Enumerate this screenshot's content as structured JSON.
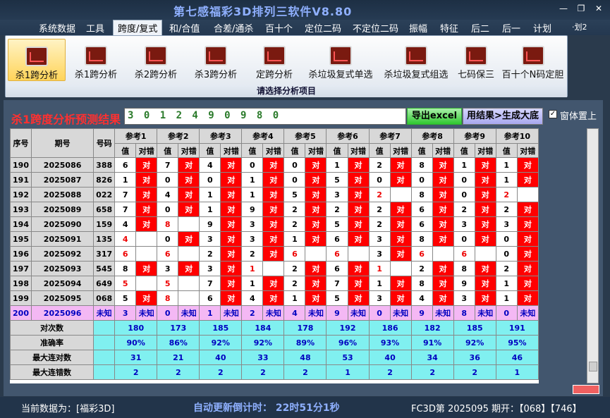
{
  "app": {
    "title": "第七感福彩3D排列三软件V8.80",
    "side_label": "·划2"
  },
  "menu": [
    "系统数据",
    "工具",
    "跨度/复式",
    "和/合值",
    "合差/通杀",
    "百十个",
    "定位二码",
    "不定位二码",
    "振幅",
    "特征",
    "后二",
    "后一",
    "计划"
  ],
  "ribbon": {
    "buttons": [
      "杀1跨分析",
      "杀1跨分析",
      "杀2跨分析",
      "杀3跨分析",
      "定跨分析",
      "杀垃圾复式单选",
      "杀垃圾复式组选",
      "七码保三",
      "百十个N码定胆"
    ],
    "caption": "请选择分析项目"
  },
  "result": {
    "label": "杀1跨度分析预测结果",
    "value": "3 0 1 2 4 9 0 9 8 0",
    "excel_button": "导出excel",
    "gen_button": "用结果>生成大底",
    "pin_label": "窗体置上",
    "pin_checked": "✓"
  },
  "table": {
    "header": {
      "seq": "序号",
      "period": "期号",
      "code": "号码",
      "refs": [
        "参考1",
        "参考2",
        "参考3",
        "参考4",
        "参考5",
        "参考6",
        "参考7",
        "参考8",
        "参考9",
        "参考10"
      ],
      "val": "值",
      "right": "对错"
    },
    "right_word": "对",
    "rows": [
      {
        "seq": "190",
        "period": "2025086",
        "code": "388",
        "vals": [
          "6",
          "7",
          "4",
          "0",
          "0",
          "1",
          "2",
          "8",
          "1",
          "1"
        ],
        "ok": [
          1,
          1,
          1,
          1,
          1,
          1,
          1,
          1,
          1,
          1
        ]
      },
      {
        "seq": "191",
        "period": "2025087",
        "code": "826",
        "vals": [
          "1",
          "0",
          "0",
          "1",
          "0",
          "5",
          "0",
          "0",
          "0",
          "1"
        ],
        "ok": [
          1,
          1,
          1,
          1,
          1,
          1,
          1,
          1,
          1,
          1
        ]
      },
      {
        "seq": "192",
        "period": "2025088",
        "code": "022",
        "vals": [
          "7",
          "4",
          "1",
          "1",
          "5",
          "3",
          "2",
          "8",
          "0",
          "2"
        ],
        "ok": [
          1,
          1,
          1,
          1,
          1,
          1,
          0,
          1,
          1,
          0
        ]
      },
      {
        "seq": "193",
        "period": "2025089",
        "code": "658",
        "vals": [
          "7",
          "0",
          "1",
          "9",
          "2",
          "2",
          "2",
          "6",
          "2",
          "2"
        ],
        "ok": [
          1,
          1,
          1,
          1,
          1,
          1,
          1,
          1,
          1,
          1
        ]
      },
      {
        "seq": "194",
        "period": "2025090",
        "code": "159",
        "vals": [
          "4",
          "8",
          "9",
          "3",
          "2",
          "5",
          "2",
          "6",
          "3",
          "3"
        ],
        "ok": [
          1,
          0,
          1,
          1,
          1,
          1,
          1,
          1,
          1,
          1
        ]
      },
      {
        "seq": "195",
        "period": "2025091",
        "code": "135",
        "vals": [
          "4",
          "0",
          "3",
          "3",
          "1",
          "6",
          "3",
          "8",
          "0",
          "0"
        ],
        "ok": [
          0,
          1,
          1,
          1,
          1,
          1,
          1,
          1,
          1,
          1
        ]
      },
      {
        "seq": "196",
        "period": "2025092",
        "code": "317",
        "vals": [
          "6",
          "6",
          "2",
          "2",
          "6",
          "6",
          "3",
          "6",
          "6",
          "0"
        ],
        "ok": [
          0,
          0,
          1,
          1,
          0,
          0,
          1,
          0,
          0,
          1
        ]
      },
      {
        "seq": "197",
        "period": "2025093",
        "code": "545",
        "vals": [
          "8",
          "3",
          "3",
          "1",
          "2",
          "6",
          "1",
          "2",
          "8",
          "2"
        ],
        "ok": [
          1,
          1,
          1,
          0,
          1,
          1,
          0,
          1,
          1,
          1
        ]
      },
      {
        "seq": "198",
        "period": "2025094",
        "code": "649",
        "vals": [
          "5",
          "5",
          "7",
          "1",
          "2",
          "7",
          "1",
          "8",
          "9",
          "1"
        ],
        "ok": [
          0,
          0,
          1,
          1,
          1,
          1,
          1,
          1,
          1,
          1
        ]
      },
      {
        "seq": "199",
        "period": "2025095",
        "code": "068",
        "vals": [
          "5",
          "8",
          "6",
          "4",
          "1",
          "5",
          "3",
          "4",
          "3",
          "1"
        ],
        "ok": [
          1,
          0,
          1,
          1,
          1,
          1,
          1,
          1,
          1,
          1
        ]
      }
    ],
    "pending": {
      "seq": "200",
      "period": "2025096",
      "code": "未知",
      "vals": [
        "3",
        "0",
        "1",
        "2",
        "4",
        "9",
        "0",
        "9",
        "8",
        "0"
      ],
      "text": "未知"
    },
    "stats": [
      {
        "label": "对次数",
        "vals": [
          "180",
          "173",
          "185",
          "184",
          "178",
          "192",
          "186",
          "182",
          "185",
          "191"
        ]
      },
      {
        "label": "准确率",
        "vals": [
          "90%",
          "86%",
          "92%",
          "92%",
          "89%",
          "96%",
          "93%",
          "91%",
          "92%",
          "95%"
        ]
      },
      {
        "label": "最大连对数",
        "vals": [
          "31",
          "21",
          "40",
          "33",
          "48",
          "53",
          "40",
          "34",
          "36",
          "46"
        ]
      },
      {
        "label": "最大连错数",
        "vals": [
          "2",
          "2",
          "2",
          "2",
          "2",
          "1",
          "2",
          "2",
          "2",
          "1"
        ]
      }
    ]
  },
  "status": {
    "current_data": "当前数据为：[福彩3D]",
    "countdown": "自动更新倒计时： 22时51分1秒",
    "draw_info": "FC3D第 2025095 期开：【068】【746】"
  },
  "colors": {
    "hit_bg": "#ff0000",
    "stat_bg": "#80f0f0",
    "pending_bg": "#f4b8f4",
    "miss_text": "#e00000"
  }
}
